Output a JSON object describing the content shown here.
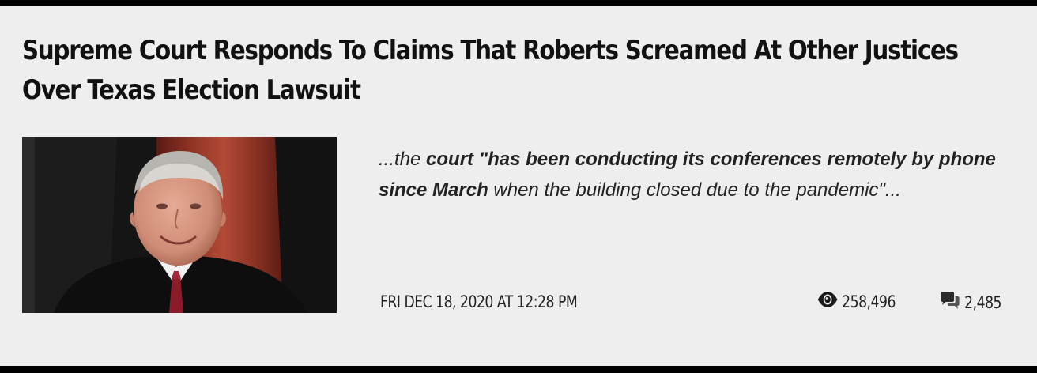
{
  "article": {
    "title_line1": "Supreme Court Responds To Claims That Roberts Screamed At Other Justices",
    "title_line2": "Over Texas Election Lawsuit",
    "excerpt": {
      "lead": "...the ",
      "bold": "court \"has been conducting its conferences remotely by phone since March",
      "rest": " when the building closed due to the pandemic\"..."
    },
    "date": "FRI DEC 18, 2020 AT 12:28 PM",
    "views": "258,496",
    "comments": "2,485"
  },
  "icons": {
    "views": "eye-icon",
    "comments": "speech-bubbles-icon"
  },
  "colors": {
    "page_background": "#eeeeee",
    "frame": "#000000",
    "text": "#111111"
  }
}
